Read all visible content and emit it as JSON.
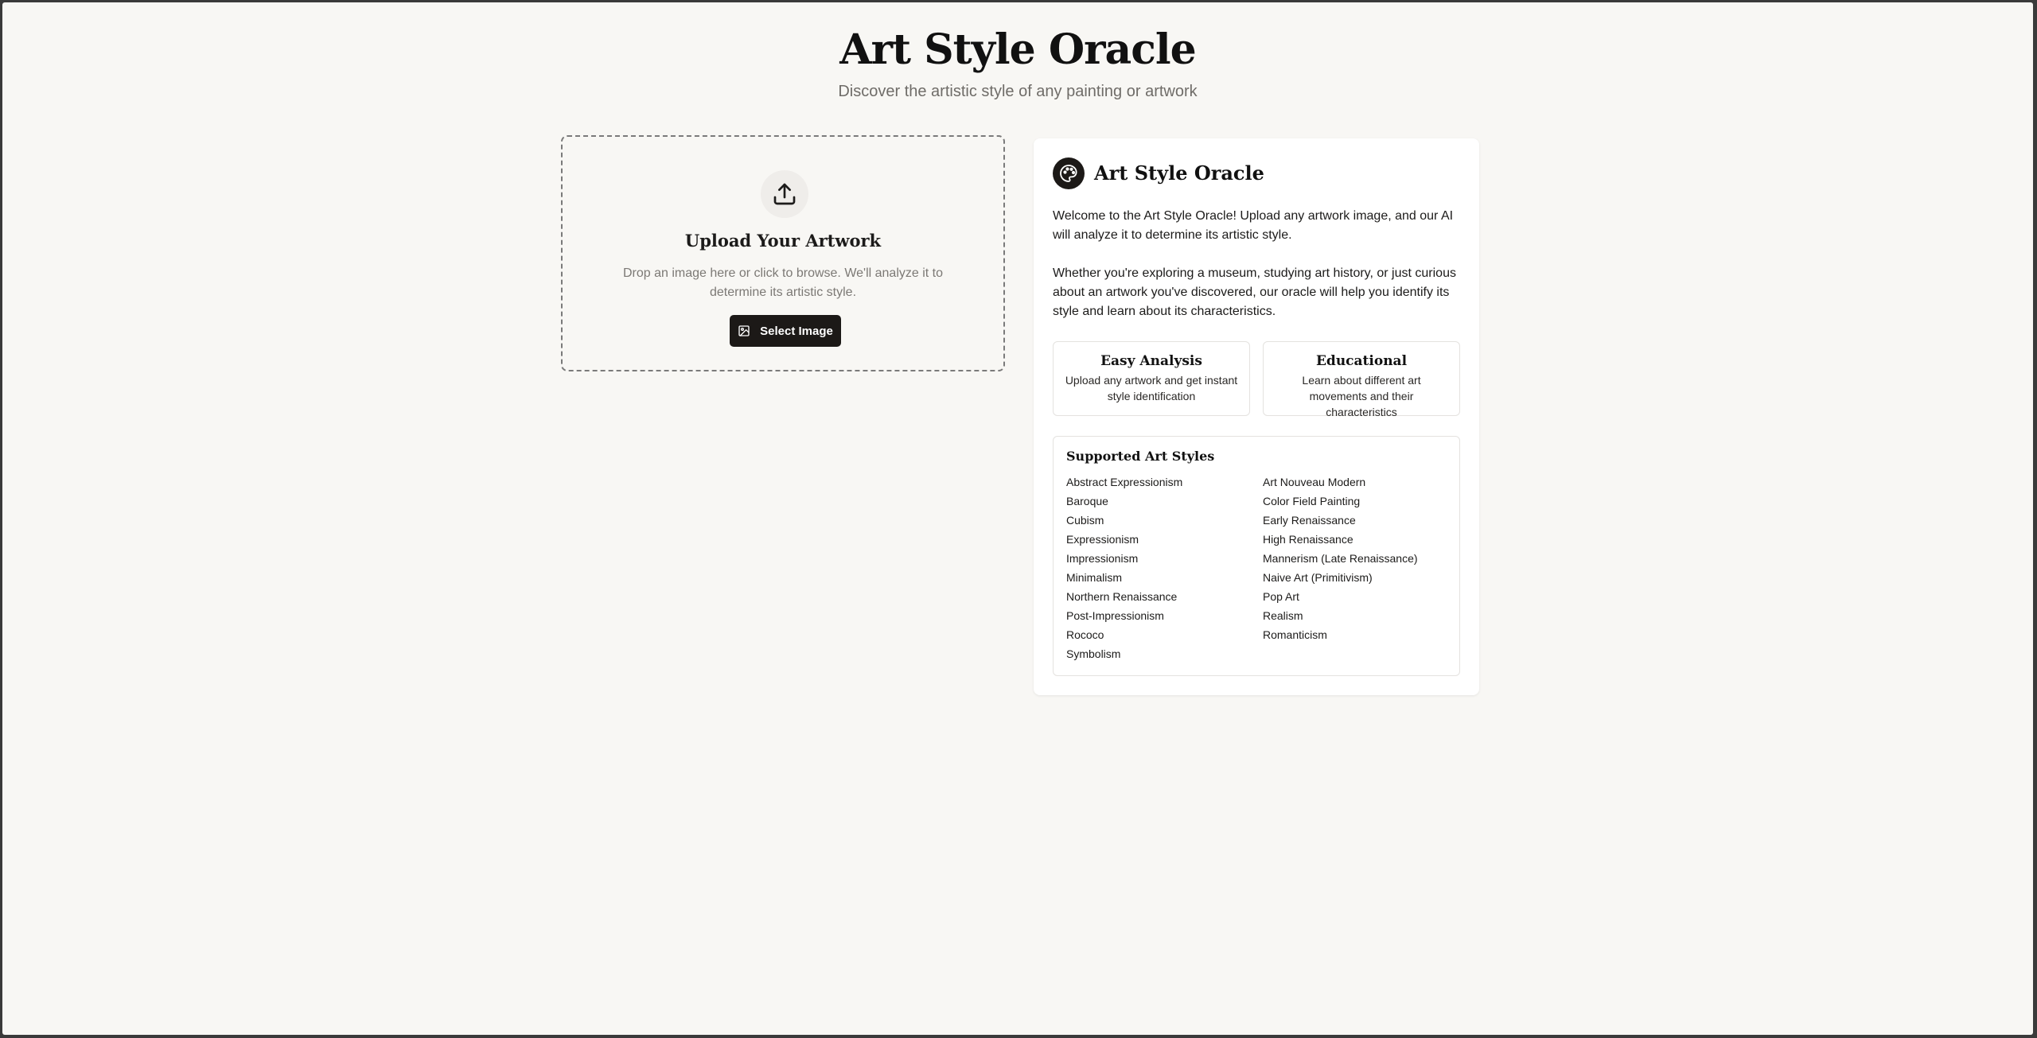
{
  "header": {
    "title": "Art Style Oracle",
    "subtitle": "Discover the artistic style of any painting or artwork"
  },
  "upload": {
    "icon": "upload-icon",
    "title": "Upload Your Artwork",
    "description": "Drop an image here or click to browse. We'll analyze it to determine its artistic style.",
    "button_icon": "image-icon",
    "button_label": "Select Image"
  },
  "info": {
    "logo_icon": "palette-icon",
    "title": "Art Style Oracle",
    "paragraph1": "Welcome to the Art Style Oracle! Upload any artwork image, and our AI will analyze it to determine its artistic style.",
    "paragraph2": "Whether you're exploring a museum, studying art history, or just curious about an artwork you've discovered, our oracle will help you identify its style and learn about its characteristics.",
    "features": [
      {
        "title": "Easy Analysis",
        "description": "Upload any artwork and get instant style identification"
      },
      {
        "title": "Educational",
        "description": "Learn about different art movements and their characteristics"
      }
    ],
    "styles_title": "Supported Art Styles",
    "styles": [
      "Abstract Expressionism",
      "Art Nouveau Modern",
      "Baroque",
      "Color Field Painting",
      "Cubism",
      "Early Renaissance",
      "Expressionism",
      "High Renaissance",
      "Impressionism",
      "Mannerism (Late Renaissance)",
      "Minimalism",
      "Naive Art (Primitivism)",
      "Northern Renaissance",
      "Pop Art",
      "Post-Impressionism",
      "Realism",
      "Rococo",
      "Romanticism",
      "Symbolism"
    ]
  },
  "colors": {
    "background": "#f8f7f4",
    "card": "#ffffff",
    "primary": "#1c1917",
    "muted_text": "#7c7975"
  }
}
